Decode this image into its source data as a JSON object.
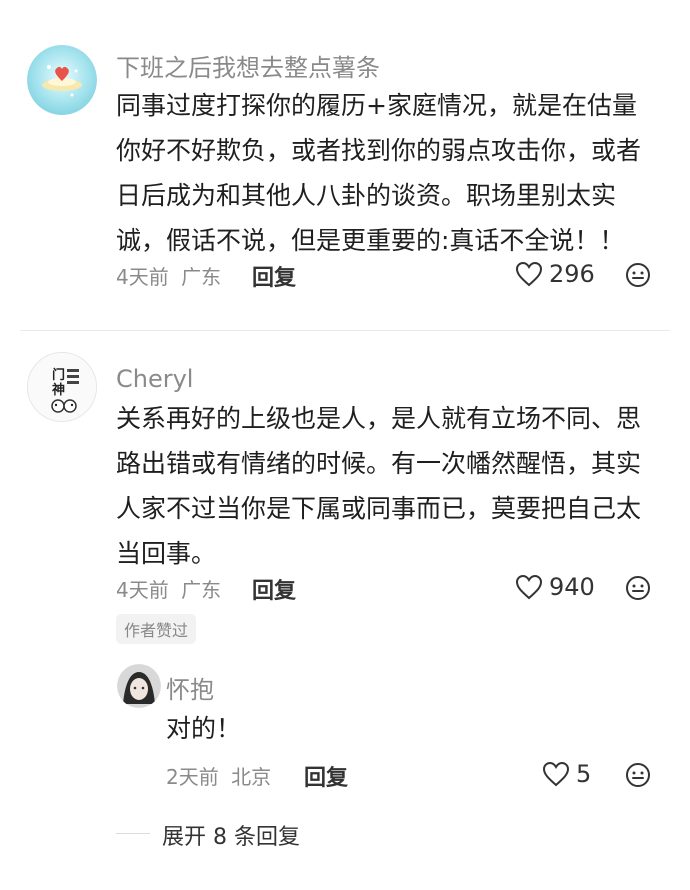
{
  "comments": [
    {
      "author": "下班之后我想去整点薯条",
      "content_lines": [
        "同事过度打探你的履历+家庭情况，就是在估量",
        "你好不好欺负，或者找到你的弱点攻击你，或者",
        "日后成为和其他人八卦的谈资。职场里别太实",
        "诚，假话不说，但是更重要的:真话不全说！！"
      ],
      "time": "4天前",
      "location": "广东",
      "reply_label": "回复",
      "likes": "296"
    },
    {
      "author": "Cheryl",
      "avatar_text": [
        "门",
        "神"
      ],
      "content_lines": [
        "关系再好的上级也是人，是人就有立场不同、思",
        "路出错或有情绪的时候。有一次幡然醒悟，其实",
        "人家不过当你是下属或同事而已，莫要把自己太",
        "当回事。"
      ],
      "time": "4天前",
      "location": "广东",
      "reply_label": "回复",
      "likes": "940",
      "badge": "作者赞过"
    }
  ],
  "reply": {
    "author": "怀抱",
    "content": "对的！",
    "time": "2天前",
    "location": "北京",
    "reply_label": "回复",
    "likes": "5"
  },
  "expand_label": "展开 8 条回复",
  "icons": {
    "like": "heart-outline-icon",
    "emoji": "smiley-icon"
  },
  "colors": {
    "text": "#1f1f1f",
    "meta": "#8a8a8a",
    "avatar1_bg": "#9fe0ea"
  }
}
